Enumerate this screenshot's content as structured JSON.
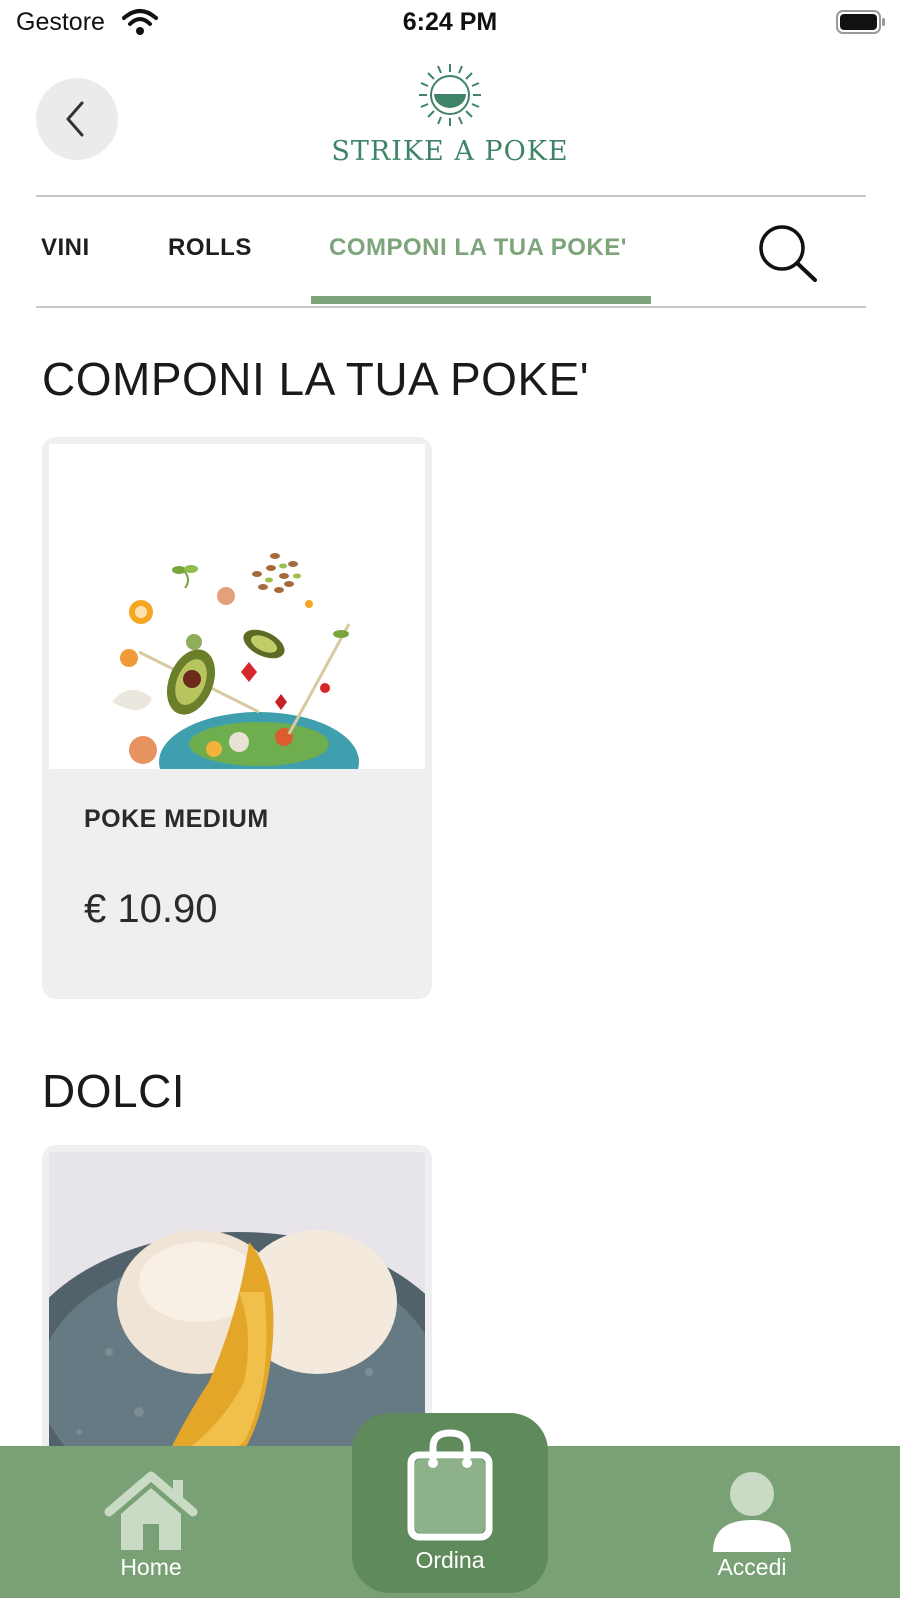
{
  "status_bar": {
    "carrier": "Gestore",
    "time": "6:24 PM"
  },
  "header": {
    "brand": "STRIKE A POKE"
  },
  "tabs": [
    {
      "label": "VINI",
      "active": false
    },
    {
      "label": "ROLLS",
      "active": false
    },
    {
      "label": "COMPONI LA TUA POKE'",
      "active": true
    }
  ],
  "sections": [
    {
      "title": "COMPONI LA TUA POKE'",
      "items": [
        {
          "name": "POKE MEDIUM",
          "price": "€ 10.90"
        }
      ]
    },
    {
      "title": "DOLCI",
      "items": [
        {
          "name": "",
          "price": ""
        }
      ]
    }
  ],
  "bottom_nav": [
    {
      "label": "Home",
      "icon": "home-icon"
    },
    {
      "label": "Ordina",
      "icon": "shopping-bag-icon"
    },
    {
      "label": "Accedi",
      "icon": "user-icon"
    }
  ],
  "colors": {
    "accent": "#7da47a",
    "nav_bg": "#7aa076",
    "nav_center": "#5f8a5b",
    "brand": "#3f8466"
  }
}
